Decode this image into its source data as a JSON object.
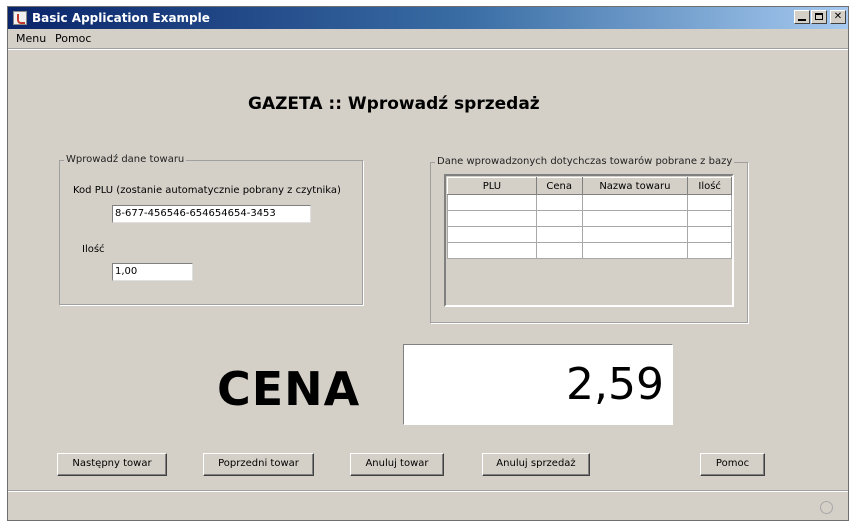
{
  "window": {
    "title": "Basic Application Example"
  },
  "menu": [
    "Menu",
    "Pomoc"
  ],
  "page_title": "GAZETA :: Wprowadź sprzedaż",
  "input_group": {
    "title": "Wprowadź dane towaru",
    "plu_label": "Kod PLU (zostanie automatycznie pobrany z czytnika)",
    "plu_value": "8-677-456546-654654654-3453",
    "qty_label": "Ilość",
    "qty_value": "1,00"
  },
  "table_group": {
    "title": "Dane wprowadzonych dotychczas towarów pobrane z bazy",
    "columns": [
      "PLU",
      "Cena",
      "Nazwa towaru",
      "Ilość"
    ]
  },
  "price": {
    "label": "CENA",
    "value": "2,59"
  },
  "buttons": {
    "next": "Następny towar",
    "prev": "Poprzedni towar",
    "cancel_item": "Anuluj towar",
    "cancel_sale": "Anuluj sprzedaż",
    "help": "Pomoc"
  },
  "colors": {
    "titlebar_start": "#0a246a",
    "titlebar_end": "#a6caf0",
    "window_bg": "#d4d0c8"
  }
}
